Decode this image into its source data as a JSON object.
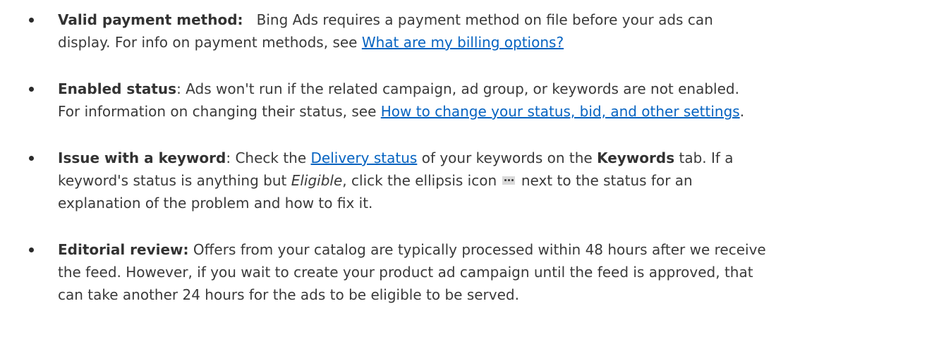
{
  "items": [
    {
      "title": "Valid payment method:",
      "line1_text": "Bing Ads requires a payment method on file before your ads can",
      "line2_text": "display. For info on payment methods, see ",
      "line2_link": "What are my billing options?"
    },
    {
      "title": "Enabled status",
      "line1_text": ": Ads won't run if the related campaign, ad group, or keywords are not enabled.",
      "line2_text": "For information on changing their status, see ",
      "line2_link": "How to change your status, bid, and other settings",
      "line2_after": "."
    },
    {
      "title": "Issue with a keyword",
      "line1_a": ": Check the ",
      "line1_link": "Delivery status",
      "line1_b": " of your keywords on the ",
      "line1_bold": "Keywords",
      "line1_c": " tab. If a",
      "line2_a": "keyword's status is anything but ",
      "line2_italic": "Eligible",
      "line2_b": ", click the ellipsis icon ",
      "line2_c": " next to the status for an",
      "line3": "explanation of the problem and how to fix it.",
      "icon": "ellipsis-icon"
    },
    {
      "title": "Editorial review:",
      "line1_text": " Offers from your catalog are typically processed within 48 hours after we receive",
      "line2": "the feed. However, if you wait to create your product ad campaign until the feed is approved, that",
      "line3": "can take another 24 hours for the ads to be eligible to be served."
    }
  ],
  "colors": {
    "text": "#3a3a3a",
    "link": "#0563c1"
  }
}
